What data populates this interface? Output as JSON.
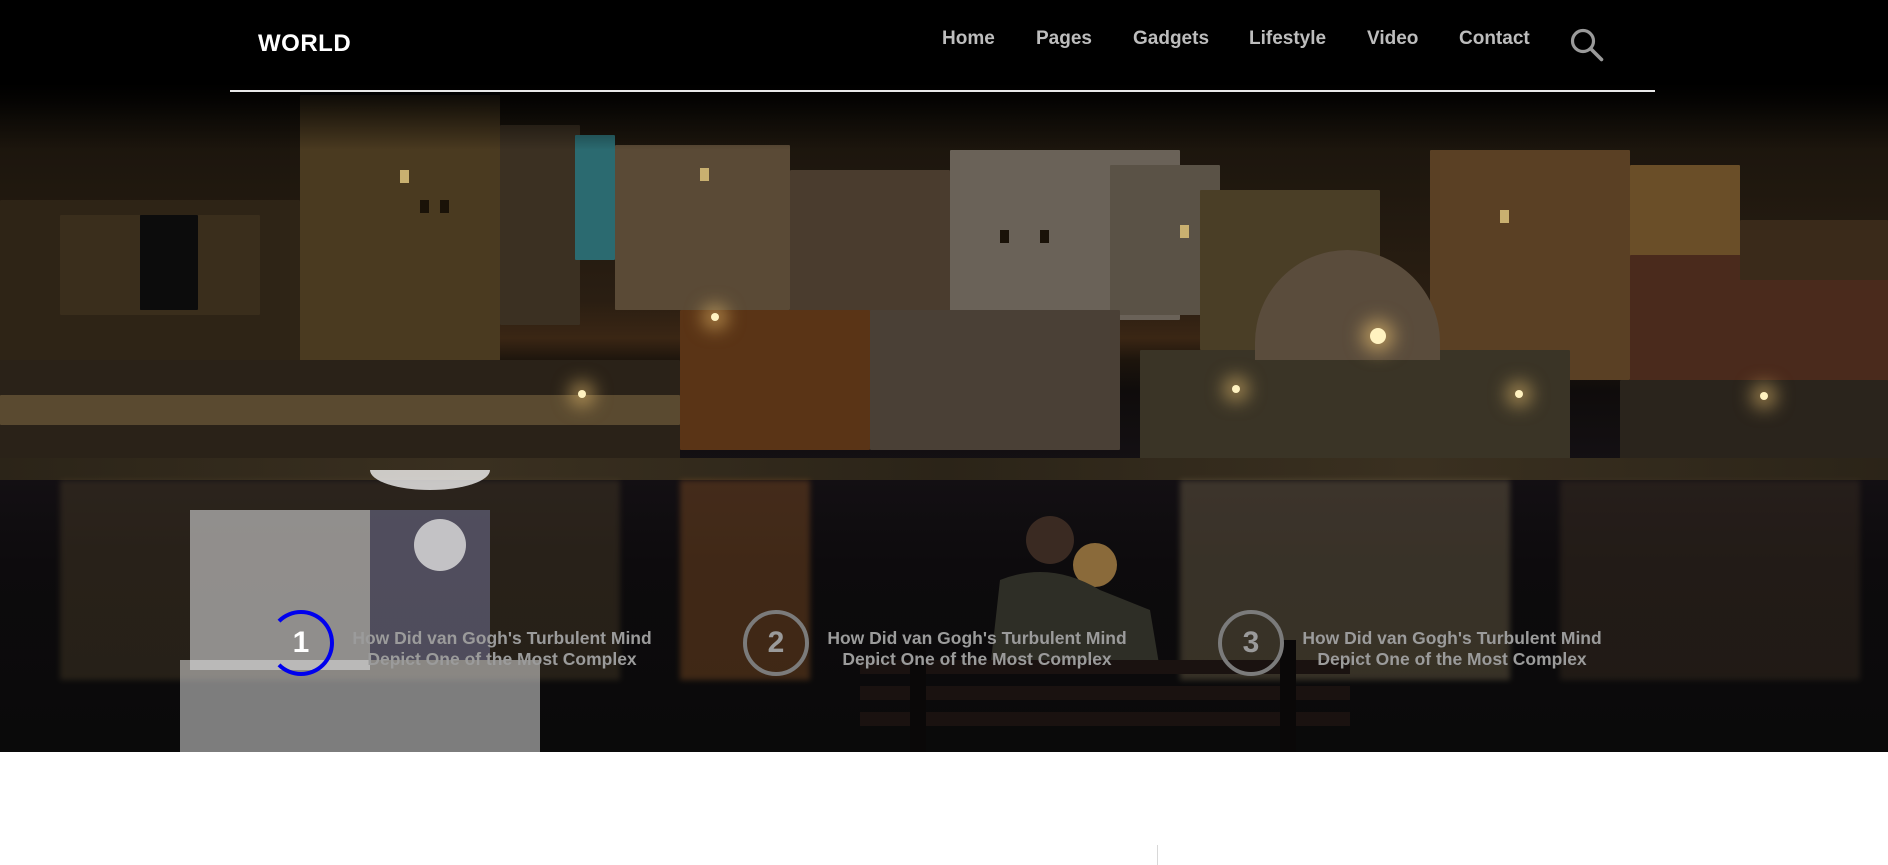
{
  "header": {
    "brand": "WORLD",
    "nav": [
      {
        "label": "Home"
      },
      {
        "label": "Pages"
      },
      {
        "label": "Gadgets"
      },
      {
        "label": "Lifestyle"
      },
      {
        "label": "Video"
      },
      {
        "label": "Contact"
      }
    ],
    "search_icon": "search-icon"
  },
  "slider": {
    "items": [
      {
        "number": "1",
        "title": "How Did van Gogh's Turbulent Mind Depict One of the Most Complex",
        "active": true
      },
      {
        "number": "2",
        "title": "How Did van Gogh's Turbulent Mind Depict One of the Most Complex",
        "active": false
      },
      {
        "number": "3",
        "title": "How Did van Gogh's Turbulent Mind Depict One of the Most Complex",
        "active": false
      }
    ]
  },
  "colors": {
    "active_ring": "#0000ee",
    "inactive_ring": "#7b7b7b",
    "nav_text": "#bdbdbd",
    "brand_text": "#ffffff",
    "header_rule": "#e8e8e8"
  }
}
